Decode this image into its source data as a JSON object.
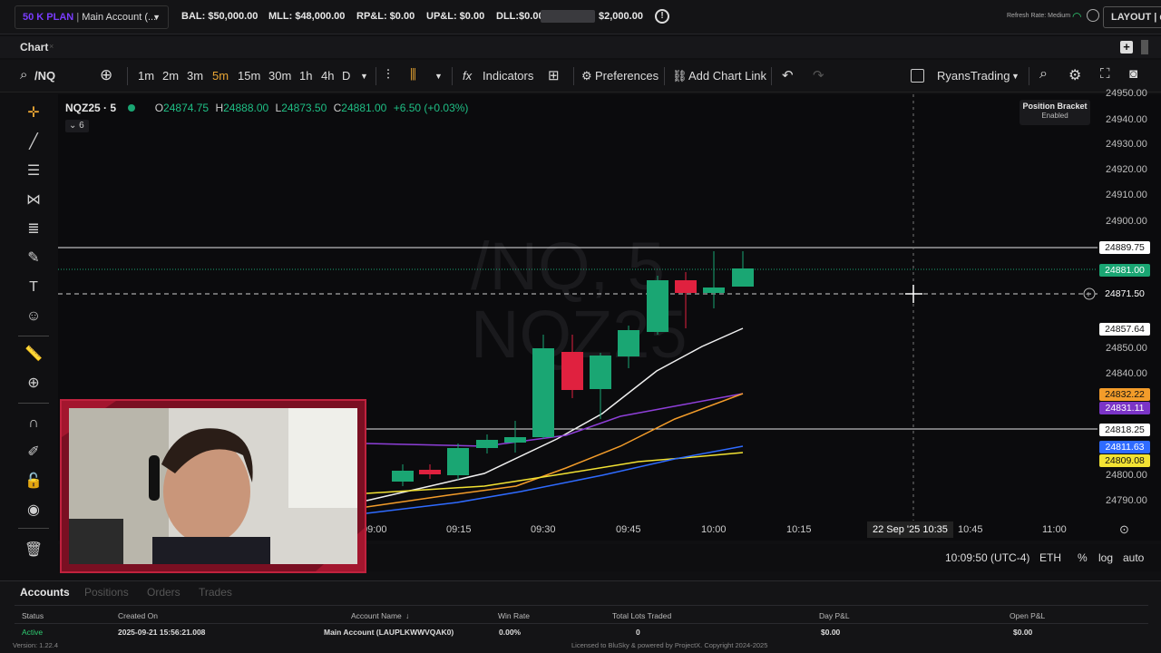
{
  "topbar": {
    "plan": "50 K PLAN",
    "account": "Main Account (...",
    "bal": "BAL: $50,000.00",
    "mll": "MLL: $48,000.00",
    "rpl": "RP&L: $0.00",
    "upl": "UP&L: $0.00",
    "dll": "DLL:$0.00",
    "dll_max": "$2,000.00",
    "refresh": "Refresh Rate: Medium",
    "layout": "LAYOUT | de"
  },
  "tabs": {
    "chart": "Chart",
    "close": "×"
  },
  "toolbar": {
    "symbol": "/NQ",
    "timeframes": [
      "1m",
      "2m",
      "3m",
      "5m",
      "15m",
      "30m",
      "1h",
      "4h",
      "D"
    ],
    "active_timeframe": "5m",
    "indicators": "Indicators",
    "preferences": "Preferences",
    "add_chart_link": "Add Chart Link",
    "profile": "RyansTrading"
  },
  "chart": {
    "symbol": "NQZ25 · 5",
    "open_label": "O",
    "open": "24874.75",
    "high_label": "H",
    "high": "24888.00",
    "low_label": "L",
    "low": "24873.50",
    "close_label": "C",
    "close": "24881.00",
    "change": "+6.50 (+0.03%)",
    "indicator_count": "6",
    "watermark_1": "/NQ, 5",
    "watermark_2": "NQZ25",
    "position_bracket": "Position Bracket",
    "bracket_state": "Enabled"
  },
  "price_axis": {
    "ticks": [
      "24950.00",
      "24940.00",
      "24930.00",
      "24920.00",
      "24910.00",
      "24900.00",
      "24850.00",
      "24840.00",
      "24800.00",
      "24790.00"
    ],
    "labels": {
      "l1": "24889.75",
      "l2": "24881.00",
      "l3": "24871.50",
      "l4": "24857.64",
      "l5": "24832.22",
      "l6": "24831.11",
      "l7": "24818.25",
      "l8": "24811.63",
      "l9": "24809.08"
    }
  },
  "time_axis": {
    "t0": "09:00",
    "t1": "09:15",
    "t2": "09:30",
    "t3": "09:45",
    "t4": "10:00",
    "t5": "10:15",
    "cursor_date": "22 Sep '25",
    "cursor_time": "10:35",
    "t6": "10:45",
    "t7": "11:00"
  },
  "status": {
    "clock": "10:09:50 (UTC-4)",
    "session": "ETH",
    "percent": "%",
    "log": "log",
    "auto": "auto"
  },
  "accounts": {
    "tabs": [
      "Accounts",
      "Positions",
      "Orders",
      "Trades"
    ],
    "headers": [
      "Status",
      "Created On",
      "Account Name",
      "Win Rate",
      "Total Lots Traded",
      "Day P&L",
      "Open P&L"
    ],
    "row": [
      "Active",
      "2025-09-21 15:56:21.008",
      "Main Account (LAUPLKWWVQAK0)",
      "0.00%",
      "0",
      "$0.00",
      "$0.00"
    ],
    "version": "Version: 1.22.4",
    "license": "Licensed to BluSky & powered by ProjectX. Copyright 2024-2025"
  },
  "colors": {
    "bull": "#1aa673",
    "bear": "#e0213f",
    "accent": "#e8a534"
  }
}
